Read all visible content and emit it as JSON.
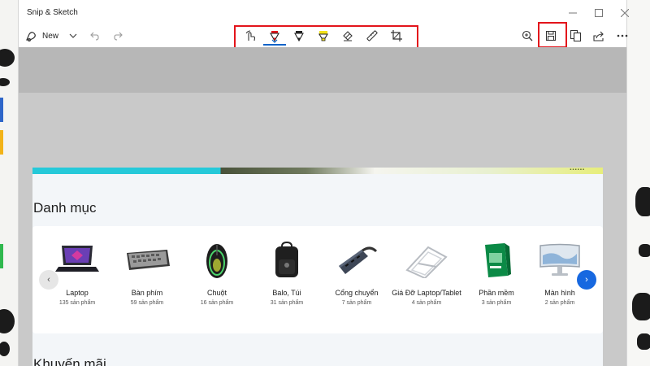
{
  "app": {
    "title": "Snip & Sketch"
  },
  "window_controls": [
    "minimize",
    "maximize",
    "close"
  ],
  "toolbar": {
    "new_label": "New",
    "left_tools": [
      "new-snip-icon",
      "chevron-down-icon",
      "undo-icon",
      "redo-icon"
    ],
    "center_tools": [
      "touch-writing-icon",
      "ballpoint-pen-icon",
      "pencil-icon",
      "highlighter-icon",
      "eraser-icon",
      "ruler-icon",
      "crop-icon"
    ],
    "right_tools": [
      "zoom-icon",
      "save-icon",
      "copy-icon",
      "share-icon",
      "more-icon"
    ],
    "selected_tool": "ballpoint-pen-icon"
  },
  "annotations": {
    "color": "#e3141b",
    "boxes": [
      "center-tools",
      "save-button"
    ]
  },
  "capture": {
    "banner_text": "▪▪▪▪▪▪",
    "section_title": "Danh mục",
    "next_section_title": "Khuyến mãi",
    "categories": [
      {
        "name": "Laptop",
        "count": "135 sản phẩm"
      },
      {
        "name": "Bàn phím",
        "count": "59 sản phẩm"
      },
      {
        "name": "Chuột",
        "count": "16 sản phẩm"
      },
      {
        "name": "Balo, Túi",
        "count": "31 sản phẩm"
      },
      {
        "name": "Cổng chuyển",
        "count": "7 sản phẩm"
      },
      {
        "name": "Giá Đỡ Laptop/Tablet",
        "count": "4 sản phẩm"
      },
      {
        "name": "Phần mềm",
        "count": "3 sản phẩm"
      },
      {
        "name": "Màn hình",
        "count": "2 sản phẩm"
      }
    ],
    "prev_arrow": "‹",
    "next_arrow": "›"
  },
  "colors": {
    "accent": "#0a63c9",
    "next_button": "#1768e0",
    "banner_cyan": "#25c9d9",
    "canvas": "#c9c9c9"
  }
}
